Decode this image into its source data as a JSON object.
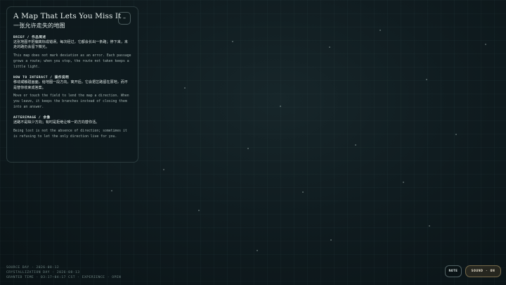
{
  "panel": {
    "title": "A Map That Lets You Miss It",
    "subtitle": "一张允许走失的地图",
    "collapse_symbol": "–",
    "sections": [
      {
        "heading": "BRIEF / 作品简述",
        "cn": "这张地图不把偏离标成错误。每次经过，它都会长出一条路；停下来，未走的路仍会留下微光。",
        "en": "This map does not mark deviation as an error. Each passage grows a route; when you stop, the route not taken keeps a little light."
      },
      {
        "heading": "HOW TO INTERACT / 操作说明",
        "cn": "移动或触碰画面，给地图一段方向。离开后，它会把岔路留在原地，而不是替你收束成答案。",
        "en": "Move or touch the field to lend the map a direction. When you leave, it keeps the branches instead of closing them into an answer."
      },
      {
        "heading": "AFTERIMAGE / 余像",
        "cn": "迷路不是缺少方向；有时是拒绝让唯一的方向替你活。",
        "en": "Being lost is not the absence of direction; sometimes it is refusing to let the only direction live for you."
      }
    ]
  },
  "footer": {
    "line1": "SOURCE DAY · 2026-08-12",
    "line2": "CRYSTALLIZATION DAY · 2026-08-13",
    "line3": "GRANTED TIME · 03:17–04:17 CST · EXPERIENCE · OPEN"
  },
  "controls": {
    "note_label": "NOTE",
    "sound_label": "SOUND · ON"
  },
  "colors": {
    "background": "#101c20",
    "panel_border": "#96b4b4",
    "sound_accent": "#c8af78"
  }
}
